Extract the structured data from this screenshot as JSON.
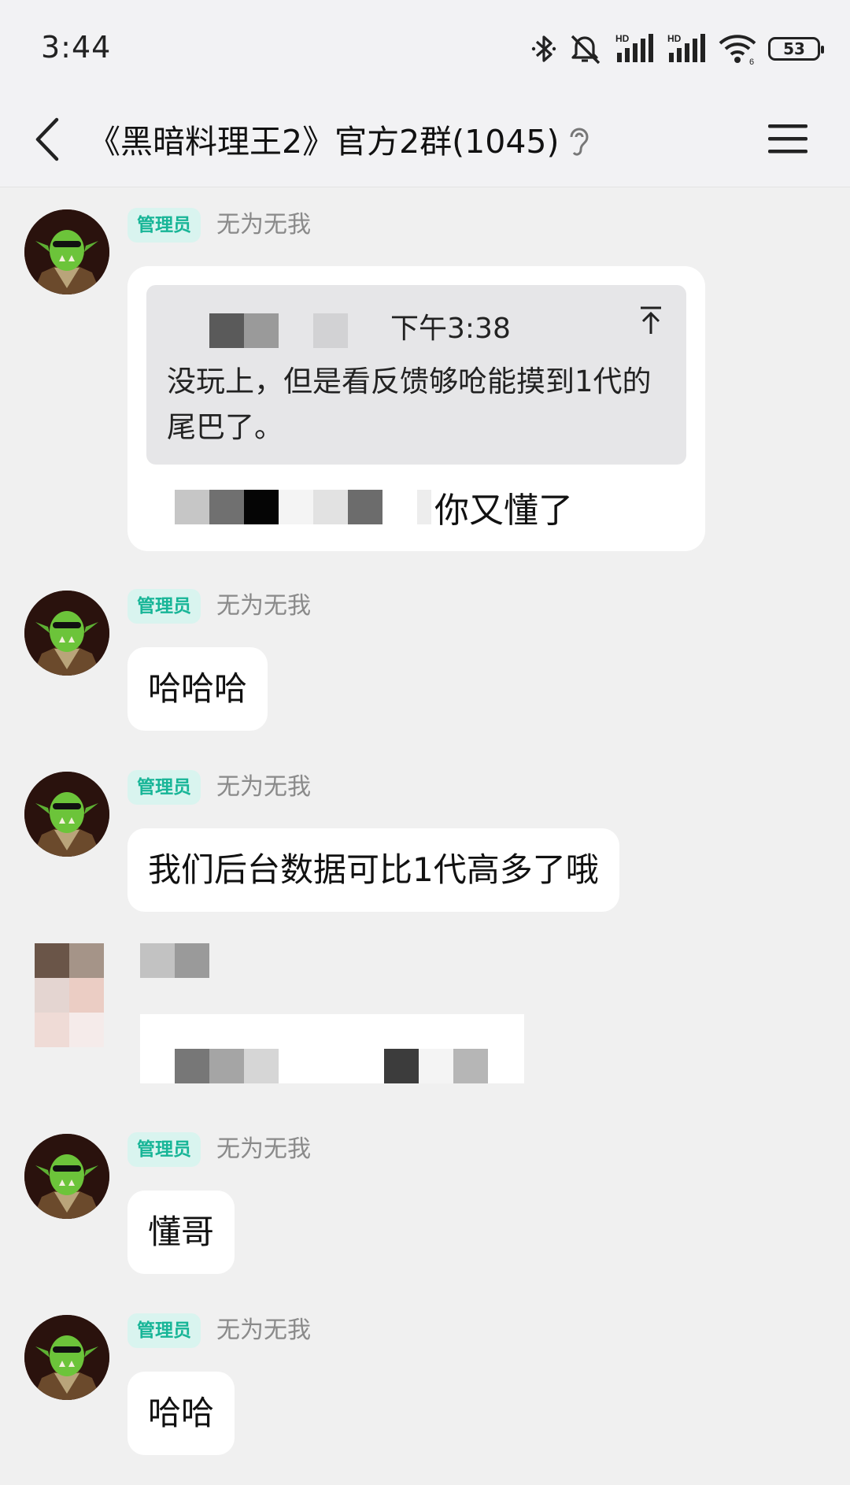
{
  "status_bar": {
    "time": "3:44",
    "battery": "53",
    "icons": [
      "bluetooth-icon",
      "mute-icon",
      "hd-signal-icon",
      "hd-signal-icon",
      "wifi-icon",
      "battery-icon"
    ]
  },
  "header": {
    "title": "《黑暗料理王2》官方2群(1045)",
    "icons": [
      "back-icon",
      "ear-icon",
      "menu-icon"
    ]
  },
  "colors": {
    "accent": "#17b597",
    "badge_bg": "#d9f4ef",
    "background": "#f0f0f0",
    "bubble": "#ffffff",
    "quote_bg": "#e6e6e8"
  },
  "messages": [
    {
      "badge": "管理员",
      "sender": "无为无我",
      "quote": {
        "time": "下午3:38",
        "text": "没玩上，但是看反馈够呛能摸到1代的尾巴了。"
      },
      "reply": "你又懂了"
    },
    {
      "badge": "管理员",
      "sender": "无为无我",
      "text": "哈哈哈"
    },
    {
      "badge": "管理员",
      "sender": "无为无我",
      "text": "我们后台数据可比1代高多了哦"
    },
    {
      "badge": "",
      "sender": "",
      "text": "",
      "redacted": true
    },
    {
      "badge": "管理员",
      "sender": "无为无我",
      "text": "懂哥"
    },
    {
      "badge": "管理员",
      "sender": "无为无我",
      "text": "哈哈"
    }
  ]
}
